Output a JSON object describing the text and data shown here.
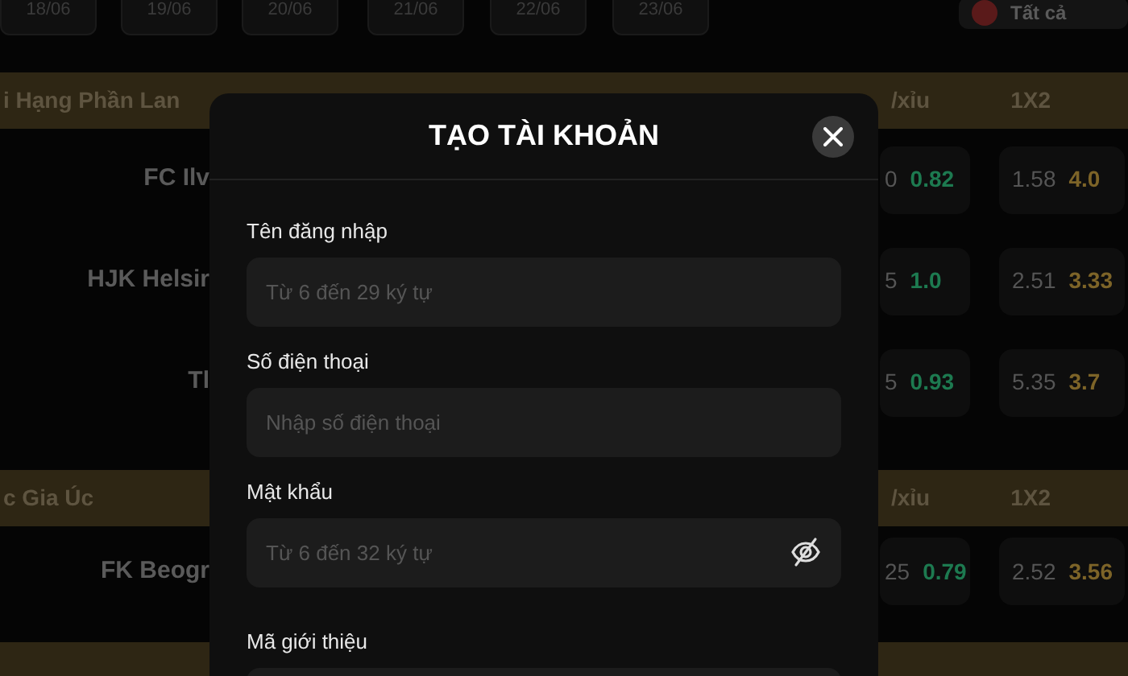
{
  "date_tabs": [
    "18/06",
    "19/06",
    "20/06",
    "21/06",
    "22/06",
    "23/06"
  ],
  "filter_button": {
    "label": "Tất cả"
  },
  "leagues": [
    {
      "name": "i Hạng Phần Lan",
      "columns": [
        "/xỉu",
        "1X2"
      ],
      "matches": [
        {
          "team": "FC Ilv",
          "over_under": [
            "0",
            "0.82"
          ],
          "result_odds": [
            "1.58",
            "4.0"
          ]
        },
        {
          "team": "HJK Helsir",
          "over_under": [
            "5",
            "1.0"
          ],
          "result_odds": [
            "2.51",
            "3.33"
          ]
        },
        {
          "team": "Tl",
          "over_under": [
            "5",
            "0.93"
          ],
          "result_odds": [
            "5.35",
            "3.7"
          ]
        }
      ]
    },
    {
      "name": "c Gia Úc",
      "columns": [
        "/xỉu",
        "1X2"
      ],
      "matches": [
        {
          "team": "FK Beogr",
          "over_under": [
            "25",
            "0.79"
          ],
          "result_odds": [
            "2.52",
            "3.56"
          ]
        }
      ]
    }
  ],
  "modal": {
    "title": "TẠO TÀI KHOẢN",
    "fields": [
      {
        "kind": "text",
        "label": "Tên đăng nhập",
        "placeholder": "Từ 6 đến 29 ký tự"
      },
      {
        "kind": "text",
        "label": "Số điện thoại",
        "placeholder": "Nhập số điện thoại"
      },
      {
        "kind": "password",
        "label": "Mật khẩu",
        "placeholder": "Từ 6 đến 32 ký tự"
      },
      {
        "kind": "text",
        "label": "Mã giới thiệu"
      }
    ]
  }
}
